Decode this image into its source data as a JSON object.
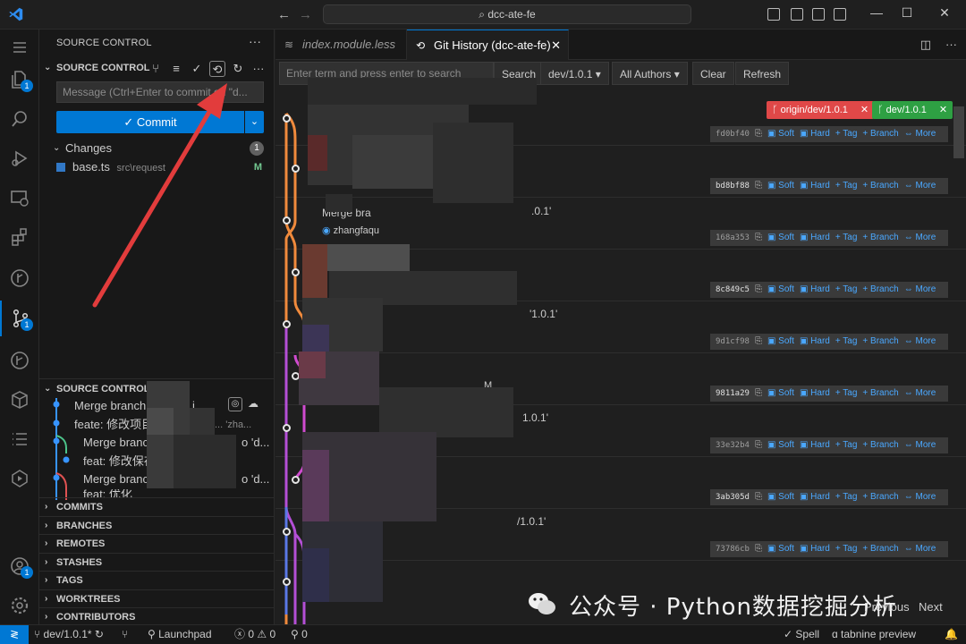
{
  "titlebar": {
    "command_center": "dcc-ate-fe",
    "back": "←",
    "forward": "→"
  },
  "activity": {
    "explorer_badge": "1",
    "scm_badge": "1",
    "account_badge": "1"
  },
  "sidebar": {
    "title": "SOURCE CONTROL",
    "scm_section": "SOURCE CONTROL",
    "message_placeholder": "Message (Ctrl+Enter to commit on \"d...",
    "commit_label": "✓ Commit",
    "changes_label": "Changes",
    "changes_count": "1",
    "file_name": "base.ts",
    "file_path": "src\\request",
    "file_status": "M",
    "graph_section": "SOURCE CONTROL G",
    "graph_rows": [
      "Merge branch '",
      "feate: 修改项目",
      "Merge branch 'dev",
      "feat: 修改保存提示",
      "Merge branch 'dev",
      "feat: 优化"
    ],
    "graph_tails": [
      "i...",
      "... 'zha...",
      "o 'd...",
      "",
      "o 'd...",
      ""
    ],
    "collapsed_sections": [
      "COMMITS",
      "BRANCHES",
      "REMOTES",
      "STASHES",
      "TAGS",
      "WORKTREES",
      "CONTRIBUTORS"
    ]
  },
  "tabs": [
    {
      "label": "index.module.less",
      "icon": "≋"
    },
    {
      "label": "Git History (dcc-ate-fe)",
      "icon": "⟲"
    }
  ],
  "history": {
    "search_placeholder": "Enter term and press enter to search",
    "search_btn": "Search",
    "branch_select": "dev/1.0.1 ▾",
    "authors_select": "All Authors ▾",
    "clear_btn": "Clear",
    "refresh_btn": "Refresh",
    "tag_remote": "ᚴ origin/dev/1.0.1",
    "tag_local": "ᚴ dev/1.0.1",
    "commits": [
      {
        "hash": "fd0bf40",
        "bright": false
      },
      {
        "hash": "bd8bf88",
        "bright": true
      },
      {
        "hash": "168a353",
        "bright": false
      },
      {
        "hash": "8c849c5",
        "bright": true
      },
      {
        "hash": "9d1cf98",
        "bright": false
      },
      {
        "hash": "9811a29",
        "bright": true
      },
      {
        "hash": "33e32b4",
        "bright": false
      },
      {
        "hash": "3ab305d",
        "bright": true
      },
      {
        "hash": "73786cb",
        "bright": false
      }
    ],
    "action_labels": {
      "soft": "Soft",
      "hard": "Hard",
      "tag": "+ Tag",
      "branch": "+ Branch",
      "more": "More"
    },
    "fragments": {
      "merge_text": "Merge bra",
      "author": "zhangfaqu",
      "ref_a": ".0.1'",
      "ref_b": "'1.0.1'",
      "ref_c": "1.0.1'",
      "ref_d": "/1.0.1'",
      "letter_m": "M"
    },
    "pager": {
      "previous": "Previous",
      "next": "Next"
    }
  },
  "watermark": "公众号 · Python数据挖掘分析",
  "statusbar": {
    "branch": "dev/1.0.1*",
    "launchpad": "Launchpad",
    "errors": "0",
    "warnings": "0",
    "ports": "0",
    "spell": "Spell",
    "tabnine": "tabnine preview"
  },
  "colors": {
    "accent": "#0078d4",
    "remote_tag": "#e04848",
    "local_tag": "#2ea043",
    "link": "#4aa8ff"
  }
}
